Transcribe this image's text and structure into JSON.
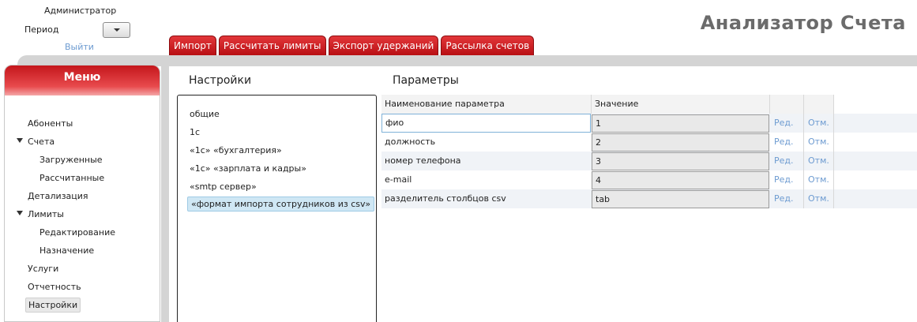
{
  "header": {
    "user_name": "Администратор",
    "period_label": "Период",
    "logout_label": "Выйти",
    "app_title": "Анализатор Счета"
  },
  "tabs": [
    {
      "label": "Импорт"
    },
    {
      "label": "Рассчитать лимиты"
    },
    {
      "label": "Экспорт удержаний"
    },
    {
      "label": "Рассылка счетов"
    }
  ],
  "menu": {
    "title": "Меню",
    "items": [
      {
        "label": "Абоненты",
        "level": 1
      },
      {
        "label": "Счета",
        "level": 1,
        "expanded": true
      },
      {
        "label": "Загруженные",
        "level": 2
      },
      {
        "label": "Рассчитанные",
        "level": 2
      },
      {
        "label": "Детализация",
        "level": 1
      },
      {
        "label": "Лимиты",
        "level": 1,
        "expanded": true
      },
      {
        "label": "Редактирование",
        "level": 2
      },
      {
        "label": "Назначение",
        "level": 2
      },
      {
        "label": "Услуги",
        "level": 1
      },
      {
        "label": "Отчетность",
        "level": 1
      },
      {
        "label": "Настройки",
        "level": 1,
        "selected": true
      }
    ]
  },
  "settings": {
    "title": "Настройки",
    "items": [
      {
        "label": "общие"
      },
      {
        "label": "1с"
      },
      {
        "label": "«1с» «бухгалтерия»"
      },
      {
        "label": "«1с» «зарплата и кадры»"
      },
      {
        "label": "«smtp сервер»"
      },
      {
        "label": "«формат импорта сотрудников из csv»",
        "selected": true
      }
    ]
  },
  "params": {
    "title": "Параметры",
    "columns": [
      "Наименование параметра",
      "Значение",
      "",
      ""
    ],
    "rows": [
      {
        "name": "фио",
        "value": "1",
        "edit": "Ред.",
        "cancel": "Отм."
      },
      {
        "name": "должность",
        "value": "2",
        "edit": "Ред.",
        "cancel": "Отм."
      },
      {
        "name": "номер телефона",
        "value": "3",
        "edit": "Ред.",
        "cancel": "Отм."
      },
      {
        "name": "e-mail",
        "value": "4",
        "edit": "Ред.",
        "cancel": "Отм."
      },
      {
        "name": "разделитель столбцов csv",
        "value": "tab",
        "edit": "Ред.",
        "cancel": "Отм."
      }
    ]
  },
  "colors": {
    "accent_red": "#c4161b",
    "link_blue": "#6d9bd1",
    "selection_blue": "#cfe7f4"
  }
}
